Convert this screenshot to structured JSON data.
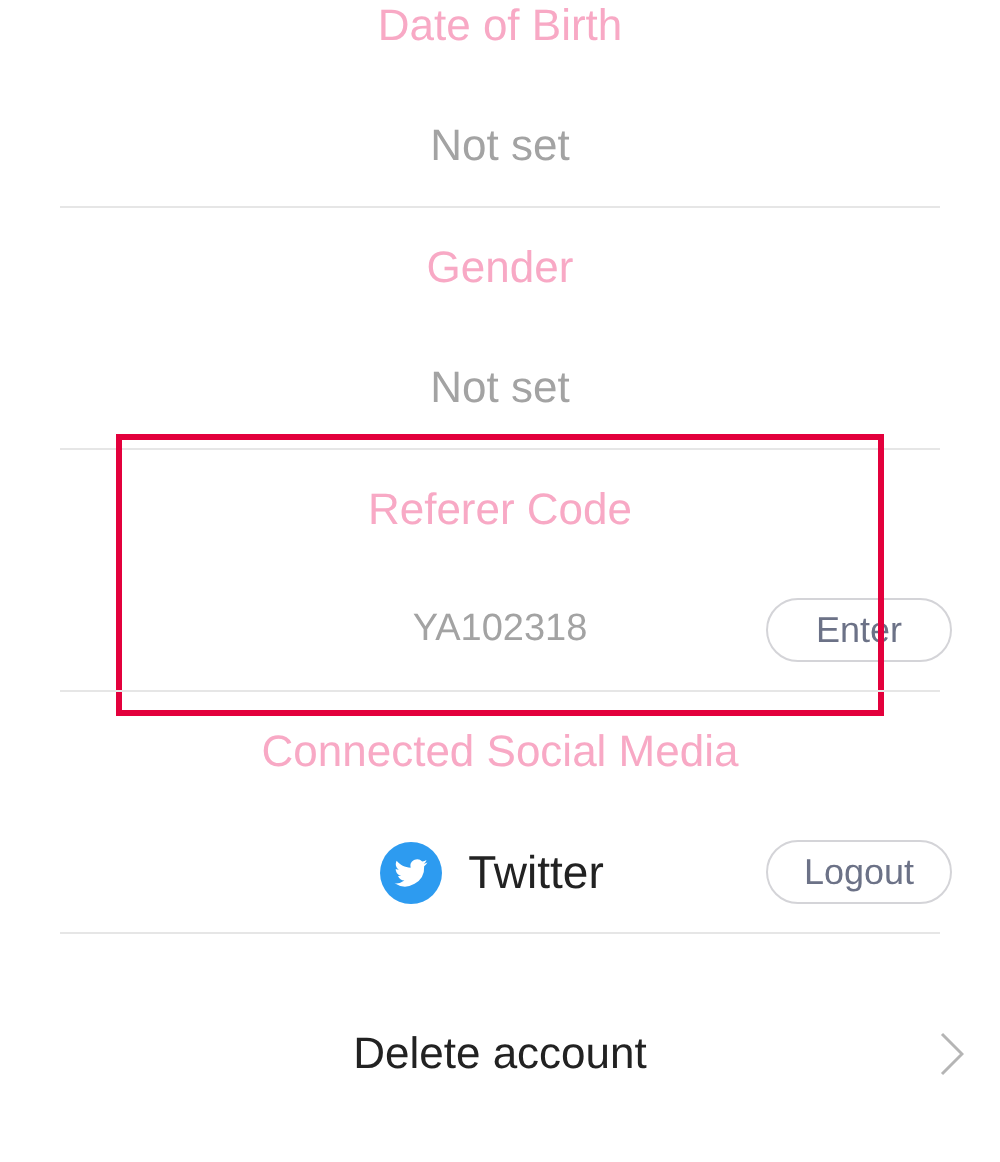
{
  "sections": [
    {
      "label": "Date of Birth",
      "kind": "text",
      "value": "Not set"
    },
    {
      "label": "Gender",
      "kind": "text",
      "value": "Not set"
    },
    {
      "label": "Referer Code",
      "kind": "code",
      "value": "YA102318",
      "button": "Enter",
      "highlighted": true
    },
    {
      "label": "Connected Social Media",
      "kind": "account",
      "value": "Twitter",
      "button": "Logout"
    }
  ],
  "delete_action": {
    "label": "Delete account"
  }
}
